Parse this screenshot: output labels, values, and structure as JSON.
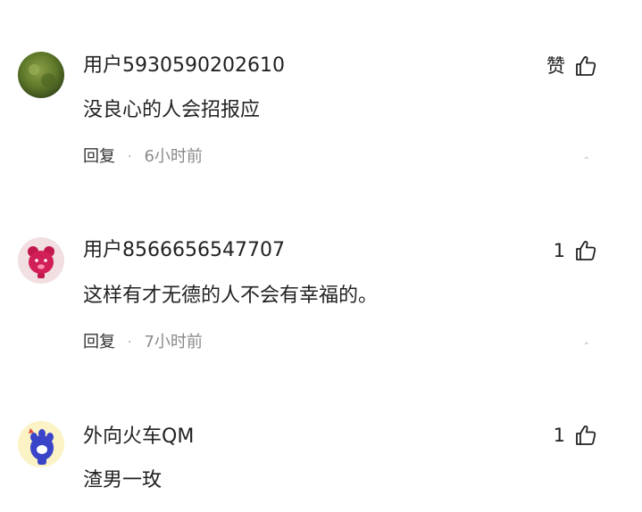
{
  "comments": [
    {
      "username": "用户5930590202610",
      "text": "没良心的人会招报应",
      "reply_label": "回复",
      "separator": "·",
      "time": "6小时前",
      "like_label": "赞",
      "avatar_icon": "green-photo-avatar"
    },
    {
      "username": "用户8566656547707",
      "text": "这样有才无德的人不会有幸福的。",
      "reply_label": "回复",
      "separator": "·",
      "time": "7小时前",
      "like_label": "1",
      "avatar_icon": "pink-bear-avatar"
    },
    {
      "username": "外向火车QM",
      "text": "渣男一玫",
      "like_label": "1",
      "avatar_icon": "cat-paw-avatar"
    }
  ],
  "colors": {
    "text_primary": "#222222",
    "text_secondary": "#8a8a8a",
    "background": "#ffffff"
  }
}
